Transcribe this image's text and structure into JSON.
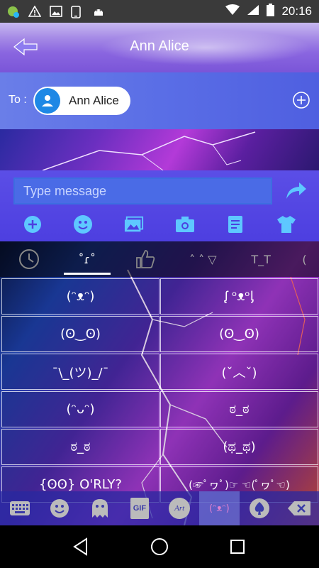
{
  "status_bar": {
    "time": "20:16"
  },
  "header": {
    "title": "Ann Alice"
  },
  "recipient": {
    "to_label": "To :",
    "name": "Ann Alice"
  },
  "compose": {
    "placeholder": "Type message"
  },
  "colors": {
    "header": "#8a66e0",
    "to_row": "#5a6ee6",
    "input_bg": "#4a6be6",
    "accent": "#1e88e5"
  },
  "keyboard": {
    "tabs": [
      "clock-icon",
      "kaomoji-tab",
      "thumbs-up-icon",
      "kaomoji-tab-2",
      "kaomoji-tab-3",
      "kaomoji-tab-4"
    ],
    "tab_labels": [
      "",
      "˚ɾ˚",
      "",
      "˄ ˄ ▽",
      "T_T",
      "("
    ],
    "kaomoji": [
      [
        "(ᵔᴥᵔ)",
        "ᶘ ᵒᴥᵒᶅ"
      ],
      [
        "(ʘ‿ʘ)",
        "(ʘ‿ʘ)"
      ],
      [
        "¯\\_(ツ)_/¯",
        "(ˇ︿ˇ)"
      ],
      [
        "(ᵔᴗᵔ)",
        "ಠ_ಠ"
      ],
      [
        "ಠ_ಠ",
        "(ಥ_ಥ)"
      ],
      [
        "{ʘʘ} O'RLY?",
        "(☞ﾟヮﾟ)☞ ☜(ﾟヮﾟ☜)"
      ]
    ],
    "bottom_bar": [
      "keyboard-icon",
      "emoji-icon",
      "ghost-icon",
      "gif-icon",
      "art-icon",
      "kaomoji-icon",
      "spade-icon",
      "delete-icon"
    ],
    "bottom_labels": [
      "",
      "",
      "",
      "GIF",
      "Art",
      "(ᵔᴥᵔ)",
      "",
      ""
    ]
  }
}
